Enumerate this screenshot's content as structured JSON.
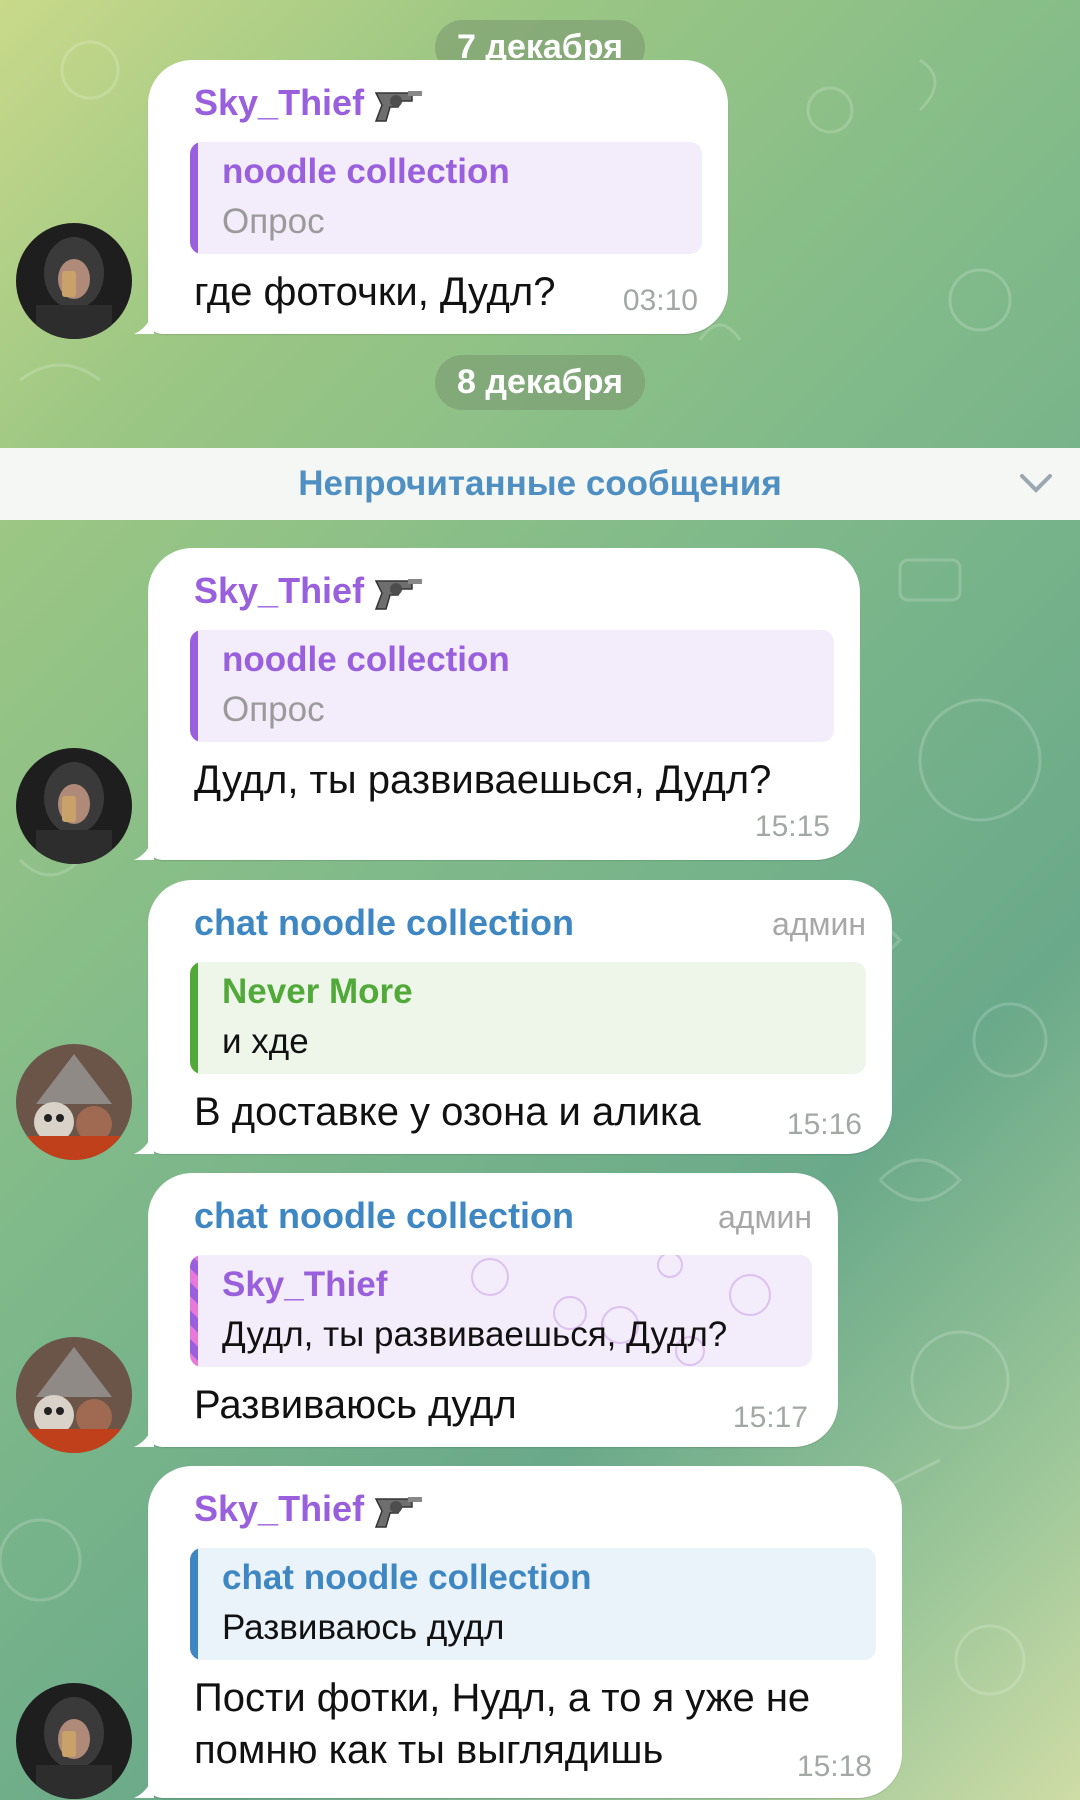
{
  "dates": [
    "7 декабря",
    "8 декабря"
  ],
  "unread": {
    "label": "Непрочитанные сообщения"
  },
  "messages": [
    {
      "sender": "Sky_Thief",
      "reply_title": "noodle collection",
      "reply_text": "Опрос",
      "text": "где фоточки, Дудл?",
      "time": "03:10",
      "admin": ""
    },
    {
      "sender": "Sky_Thief",
      "reply_title": "noodle collection",
      "reply_text": "Опрос",
      "text": "Дудл, ты развиваешься, Дудл?",
      "time": "15:15",
      "admin": ""
    },
    {
      "sender": "chat noodle collection",
      "reply_title": "Never More",
      "reply_text": "и хде",
      "text": "В доставке у озона и алика",
      "time": "15:16",
      "admin": "админ"
    },
    {
      "sender": "chat noodle collection",
      "reply_title": "Sky_Thief",
      "reply_text": "Дудл, ты развиваешься, Дудл?",
      "text": "Развиваюсь дудл",
      "time": "15:17",
      "admin": "админ"
    },
    {
      "sender": "Sky_Thief",
      "reply_title": "chat noodle collection",
      "reply_text": "Развиваюсь дудл",
      "text_line1": "Пости фотки, Нудл, а то я уже не",
      "text_line2": "помню как ты выглядишь",
      "time": "15:18",
      "admin": ""
    }
  ],
  "colors": {
    "purple": "#9a5fdc",
    "blue": "#3f87c2",
    "green": "#51a93a"
  },
  "icons": {
    "revolver": "revolver-icon",
    "chevron": "chevron-down-icon"
  }
}
